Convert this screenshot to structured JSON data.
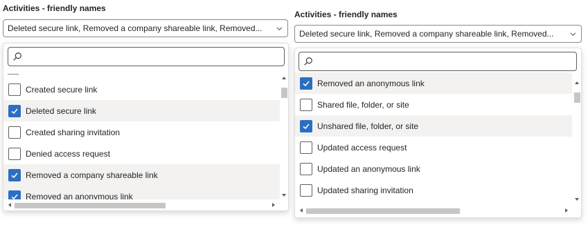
{
  "left_panel": {
    "title": "Activities - friendly names",
    "dropdown_value": "Deleted secure link, Removed a company shareable link, Removed...",
    "search_placeholder": "",
    "items": [
      {
        "label": "Created secure link",
        "checked": false
      },
      {
        "label": "Deleted secure link",
        "checked": true
      },
      {
        "label": "Created sharing invitation",
        "checked": false
      },
      {
        "label": "Denied access request",
        "checked": false
      },
      {
        "label": "Removed a company shareable link",
        "checked": true
      },
      {
        "label": "Removed an anonymous link",
        "checked": true
      }
    ]
  },
  "right_panel": {
    "title": "Activities - friendly names",
    "dropdown_value": "Deleted secure link, Removed a company shareable link, Removed...",
    "search_placeholder": "",
    "items": [
      {
        "label": "Removed an anonymous link",
        "checked": true
      },
      {
        "label": "Shared file, folder, or site",
        "checked": false
      },
      {
        "label": "Unshared file, folder, or site",
        "checked": true
      },
      {
        "label": "Updated access request",
        "checked": false
      },
      {
        "label": "Updated an anonymous link",
        "checked": false
      },
      {
        "label": "Updated sharing invitation",
        "checked": false
      }
    ]
  },
  "colors": {
    "checkbox_checked": "#2b6fc2",
    "selected_row": "#f3f2f1",
    "scroll_thumb": "#c8c6c4"
  },
  "icons": {
    "search": "search-icon",
    "dropdown": "chevron-down-icon",
    "check": "checkmark-icon"
  }
}
